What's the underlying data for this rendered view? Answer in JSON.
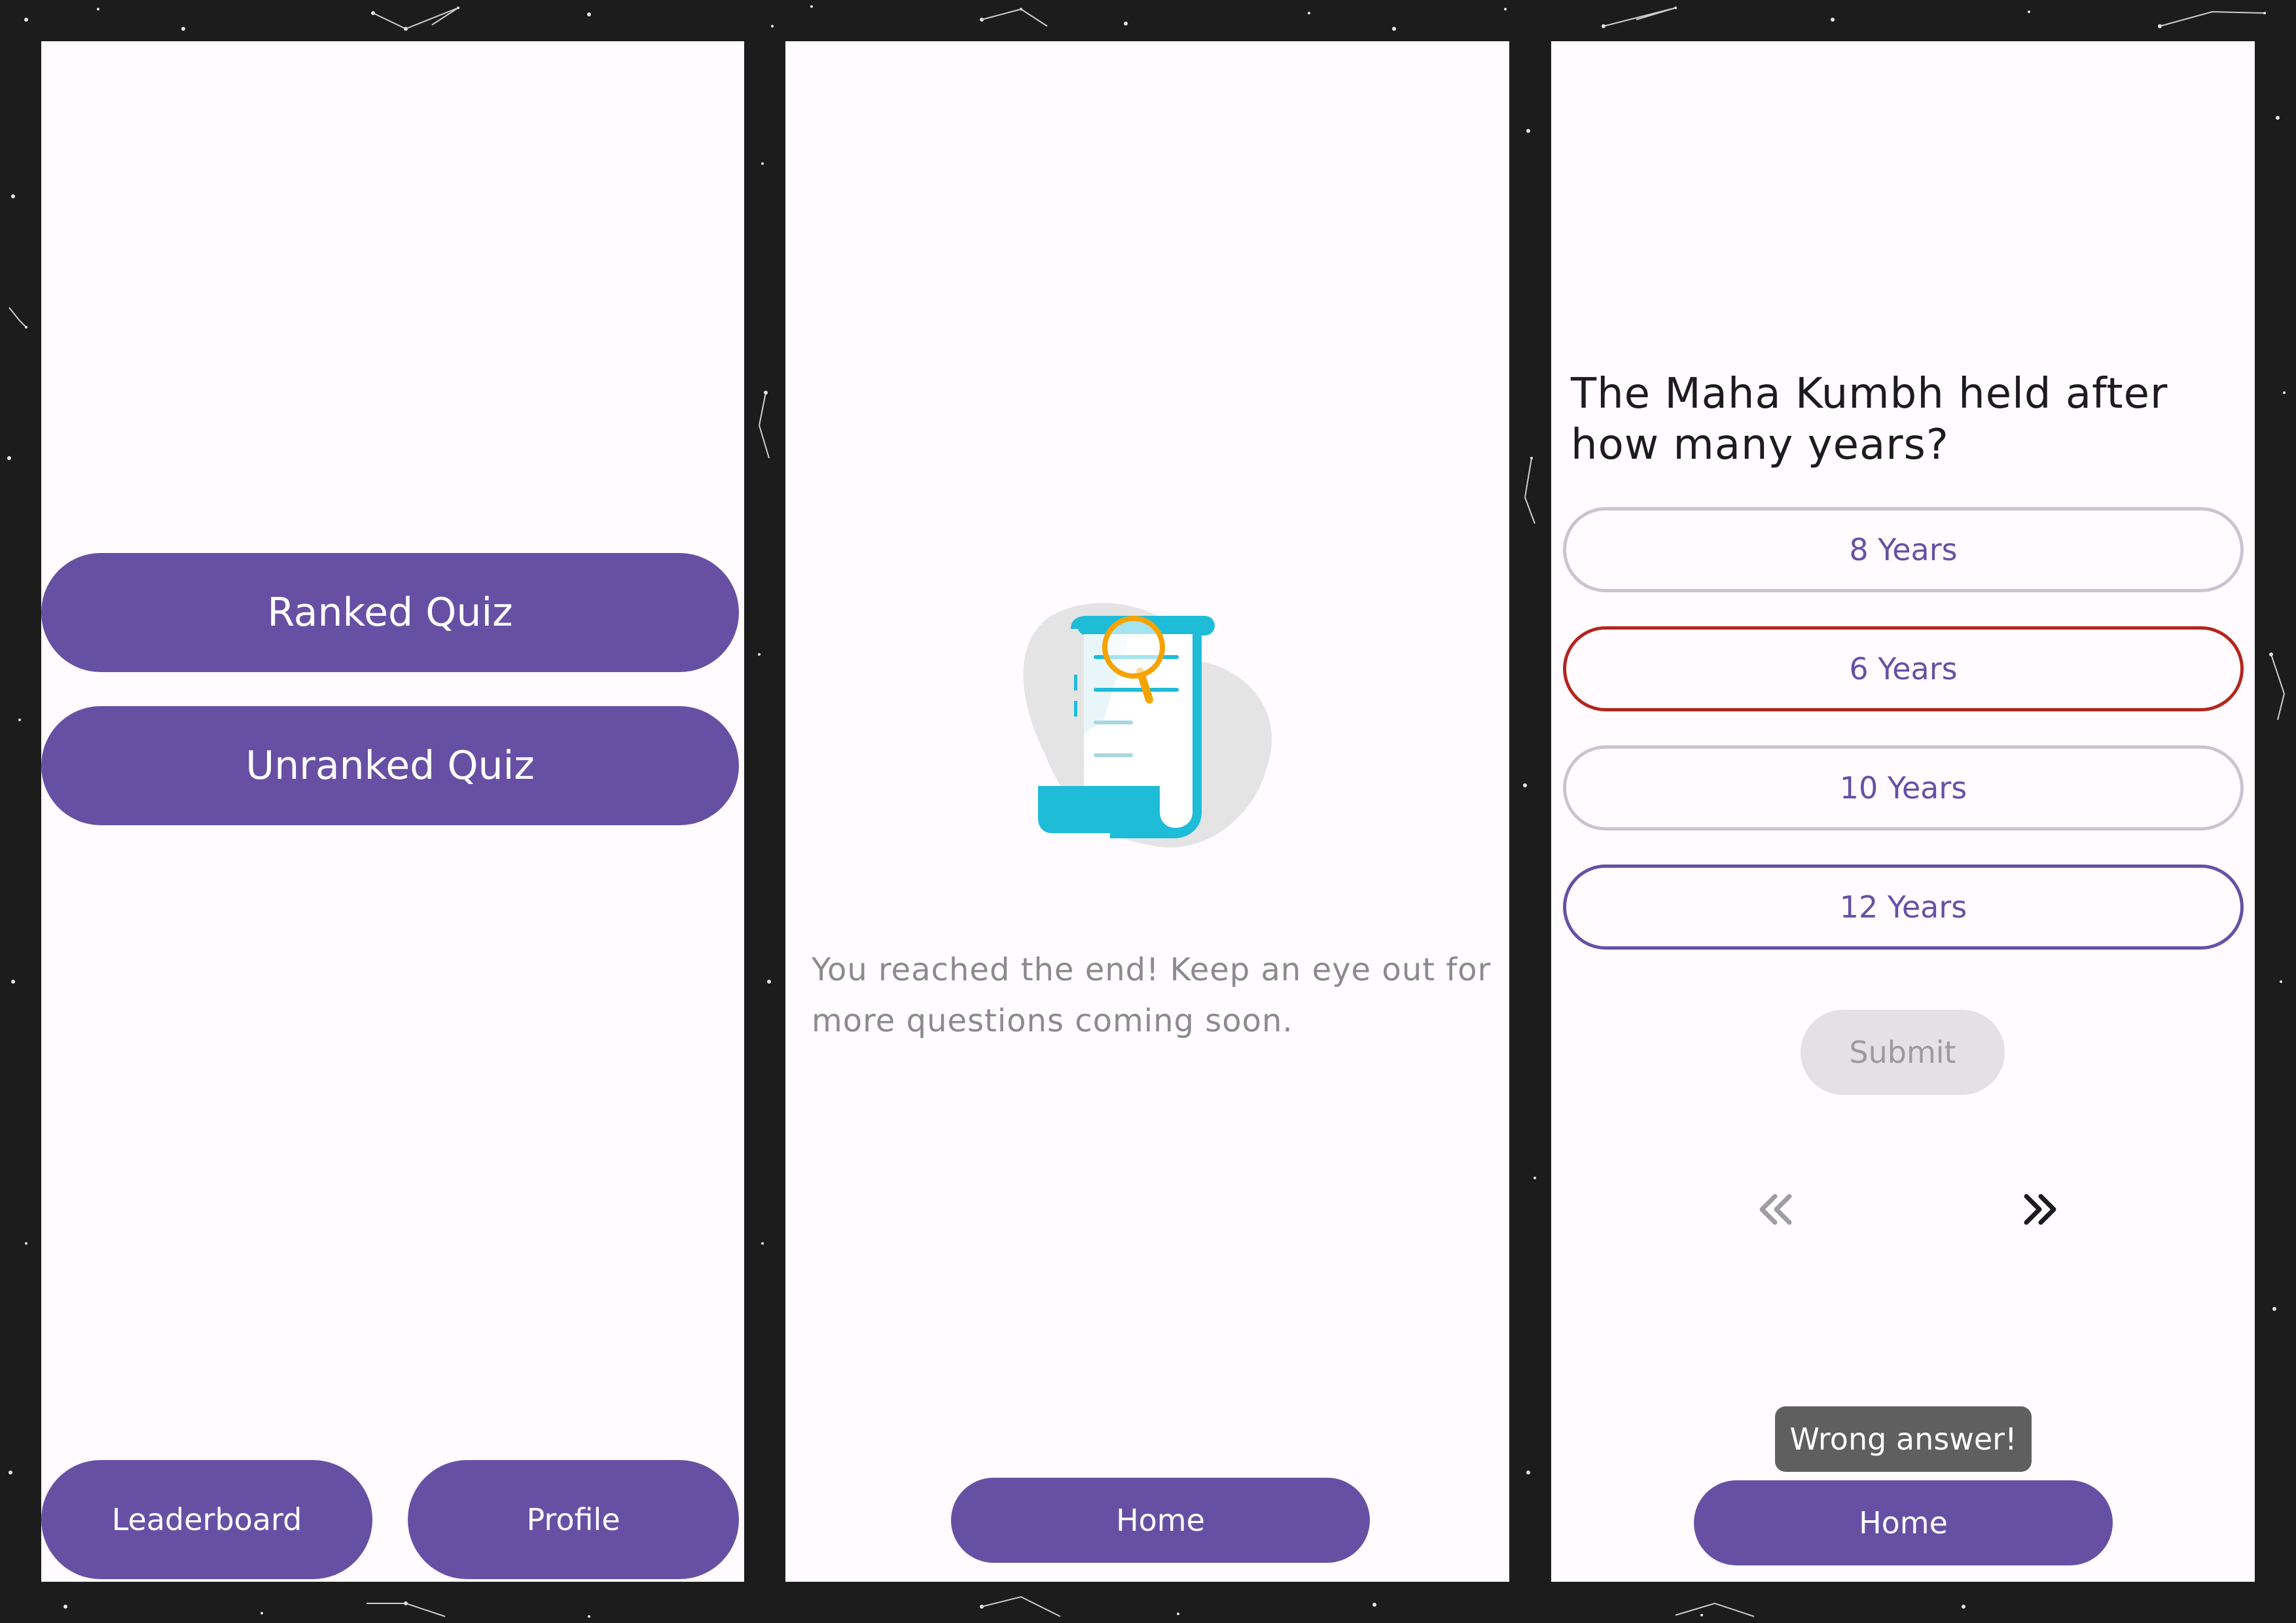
{
  "screen_menu": {
    "ranked_quiz_label": "Ranked Quiz",
    "unranked_quiz_label": "Unranked Quiz",
    "leaderboard_label": "Leaderboard",
    "profile_label": "Profile"
  },
  "screen_end": {
    "illustration_icon": "document-search-icon",
    "message": "You reached the end! Keep an eye out for more questions coming soon.",
    "home_label": "Home"
  },
  "screen_question": {
    "question": "The Maha Kumbh held after how many years?",
    "options": [
      {
        "label": "8 Years",
        "state": "default"
      },
      {
        "label": "6 Years",
        "state": "wrong"
      },
      {
        "label": "10 Years",
        "state": "default"
      },
      {
        "label": "12 Years",
        "state": "selected"
      }
    ],
    "submit_label": "Submit",
    "prev_icon": "double-chevron-left-icon",
    "next_icon": "double-chevron-right-icon",
    "toast": "Wrong answer!",
    "home_label": "Home"
  },
  "colors": {
    "primary": "#6750a4",
    "wrong": "#b3261e",
    "screen_bg": "#fffbfe",
    "backdrop": "#1d1c1c",
    "illustration_accent": "#1fbcd8",
    "magnifier": "#f5a300"
  }
}
